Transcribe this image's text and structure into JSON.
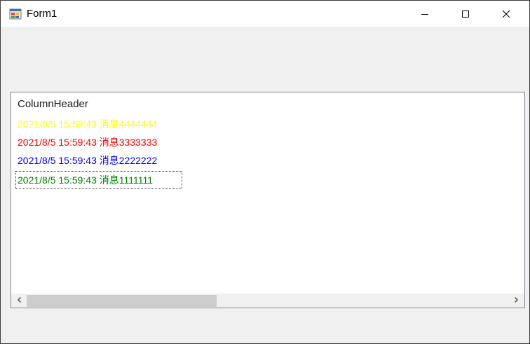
{
  "window": {
    "title": "Form1",
    "app_icon": "winforms-form-icon",
    "controls": {
      "minimize_icon": "minimize-icon",
      "maximize_icon": "maximize-icon",
      "close_icon": "close-icon"
    }
  },
  "listview": {
    "column_header": "ColumnHeader",
    "items": [
      {
        "text": "2021/8/5 15:59:43 消息4444444",
        "color": "#ffff00"
      },
      {
        "text": "2021/8/5 15:59:43 消息3333333",
        "color": "#ff0000"
      },
      {
        "text": "2021/8/5 15:59:43 消息2222222",
        "color": "#0000ff"
      },
      {
        "text": "2021/8/5 15:59:43 消息1111111",
        "color": "#008000",
        "focused": true
      }
    ],
    "scrollbar": {
      "left_icon": "chevron-left-icon",
      "right_icon": "chevron-right-icon"
    }
  }
}
